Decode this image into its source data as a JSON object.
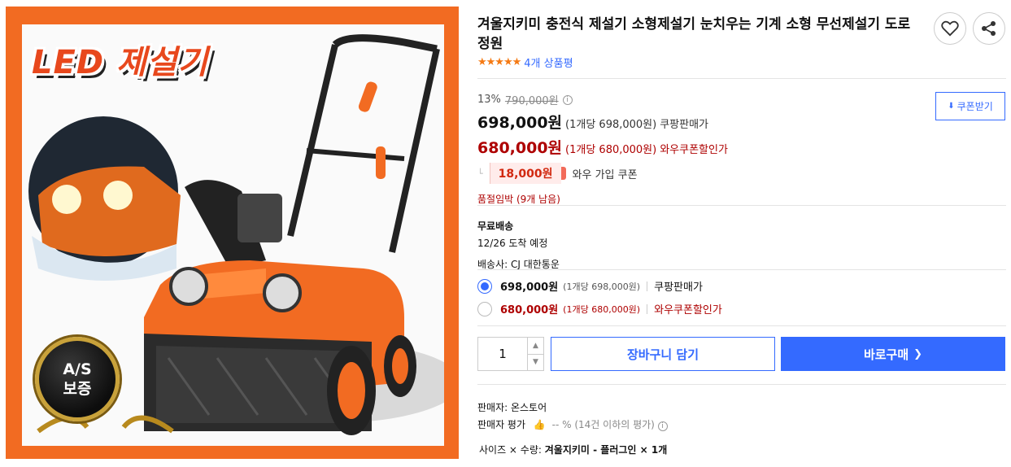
{
  "image": {
    "headline": "LED 제설기",
    "badge_line1": "A/S",
    "badge_line2": "보증"
  },
  "product": {
    "title": "겨울지키미 충전식 제설기 소형제설기 눈치우는 기계 소형 무선제설기 도로 정원",
    "stars": "★★★★★",
    "review_count": "4개 상품평"
  },
  "pricing": {
    "discount_rate": "13%",
    "original_price": "790,000원",
    "info_icon": "i",
    "coupon_download": "쿠폰받기",
    "coupang_price": "698,000원",
    "coupang_unit": "(1개당 698,000원)",
    "coupang_label": "쿠팡판매가",
    "wow_price": "680,000원",
    "wow_unit": "(1개당 680,000원)",
    "wow_label": "와우쿠폰할인가",
    "coupon_amount": "18,000원",
    "coupon_text": "와우 가입 쿠폰",
    "stock_notice": "품절임박 (9개 남음)"
  },
  "delivery": {
    "type": "무료배송",
    "arrival": "12/26 도착 예정",
    "carrier": "배송사: CJ 대한통운"
  },
  "options": [
    {
      "price": "698,000원",
      "unit": "(1개당 698,000원)",
      "label": "쿠팡판매가",
      "selected": true
    },
    {
      "price": "680,000원",
      "unit": "(1개당 680,000원)",
      "label": "와우쿠폰할인가",
      "selected": false
    }
  ],
  "purchase": {
    "quantity": "1",
    "cart_label": "장바구니 담기",
    "buy_label": "바로구매",
    "buy_arrow": "❯"
  },
  "seller": {
    "name_line": "판매자: 온스토어",
    "rating_label": "판매자 평가",
    "rating_value": "-- %",
    "rating_note": "(14건 이하의 평가)",
    "info_icon": "i"
  },
  "selection": {
    "label": "사이즈 × 수량:",
    "value": "겨울지키미 - 플러그인 × 1개"
  },
  "colors": {
    "accent_blue": "#346aff",
    "price_red": "#ae0000",
    "brand_orange": "#f26b22"
  }
}
